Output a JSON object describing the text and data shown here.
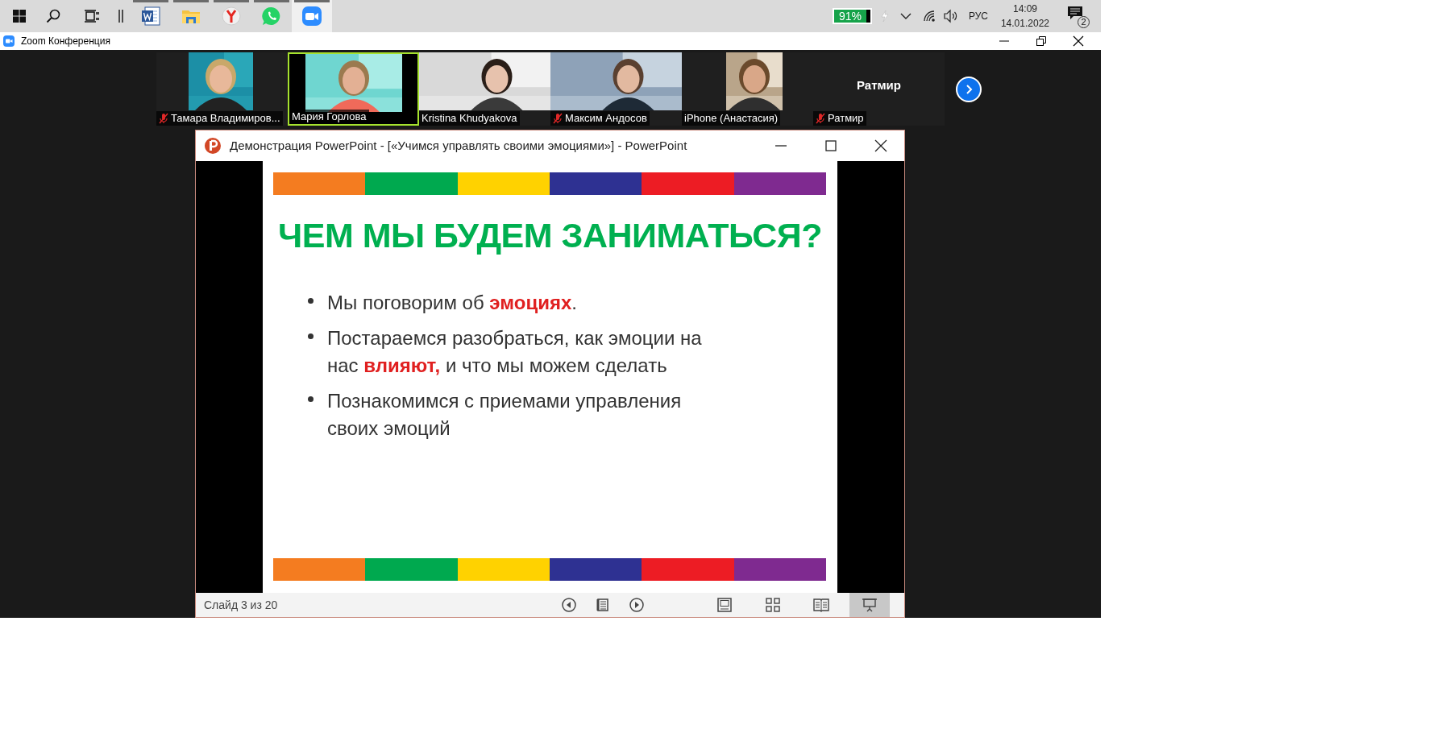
{
  "taskbar": {
    "apps": [
      {
        "kind": "word",
        "running": true,
        "active": false
      },
      {
        "kind": "folder",
        "running": true,
        "active": false
      },
      {
        "kind": "browser",
        "running": true,
        "active": false
      },
      {
        "kind": "whatsapp",
        "running": true,
        "active": false
      },
      {
        "kind": "zoom",
        "running": true,
        "active": true
      }
    ],
    "tray": {
      "battery": "91%",
      "language": "РУС",
      "time": "14:09",
      "date": "14.01.2022",
      "notifications": "2"
    }
  },
  "window": {
    "title": "Zoom Конференция"
  },
  "participants": [
    {
      "name": "Тамара Владимиров...",
      "muted": true,
      "speaking": false,
      "kind": "video"
    },
    {
      "name": "Мария Горлова",
      "muted": false,
      "speaking": true,
      "kind": "video"
    },
    {
      "name": "Kristina Khudyakova",
      "muted": false,
      "speaking": false,
      "kind": "video"
    },
    {
      "name": "Максим Андосов",
      "muted": true,
      "speaking": false,
      "kind": "video"
    },
    {
      "name": "iPhone (Анастасия)",
      "muted": false,
      "speaking": false,
      "kind": "video"
    },
    {
      "name": "Ратмир",
      "muted": true,
      "speaking": false,
      "kind": "name_card",
      "card_name": "Ратмир"
    }
  ],
  "presentation": {
    "title": "Демонстрация PowerPoint - [«Учимся управлять своими эмоциями»] - PowerPoint",
    "slide": {
      "title": "ЧЕМ МЫ БУДЕМ ЗАНИМАТЬСЯ?",
      "stripes": [
        {
          "color": "#f47c20"
        },
        {
          "color": "#00a94f"
        },
        {
          "color": "#ffd200"
        },
        {
          "color": "#2e3192"
        },
        {
          "color": "#ed1c24"
        },
        {
          "color": "#7f2a90"
        }
      ],
      "bullets": [
        [
          {
            "text": "Мы поговорим об ",
            "highlight": false
          },
          {
            "text": "эмоциях",
            "highlight": true
          },
          {
            "text": ".",
            "highlight": false
          }
        ],
        [
          {
            "text": "Постараемся разобраться, как эмоции на нас ",
            "highlight": false
          },
          {
            "text": "влияют,",
            "highlight": true
          },
          {
            "text": " и что мы можем сделать",
            "highlight": false
          }
        ],
        [
          {
            "text": "Познакомимся с приемами управления своих эмоций",
            "highlight": false
          }
        ]
      ]
    },
    "status": "Слайд 3 из 20",
    "views": [
      {
        "kind": "normal",
        "selected": false
      },
      {
        "kind": "sorter",
        "selected": false
      },
      {
        "kind": "reading",
        "selected": false
      },
      {
        "kind": "slideshow",
        "selected": true
      }
    ]
  }
}
